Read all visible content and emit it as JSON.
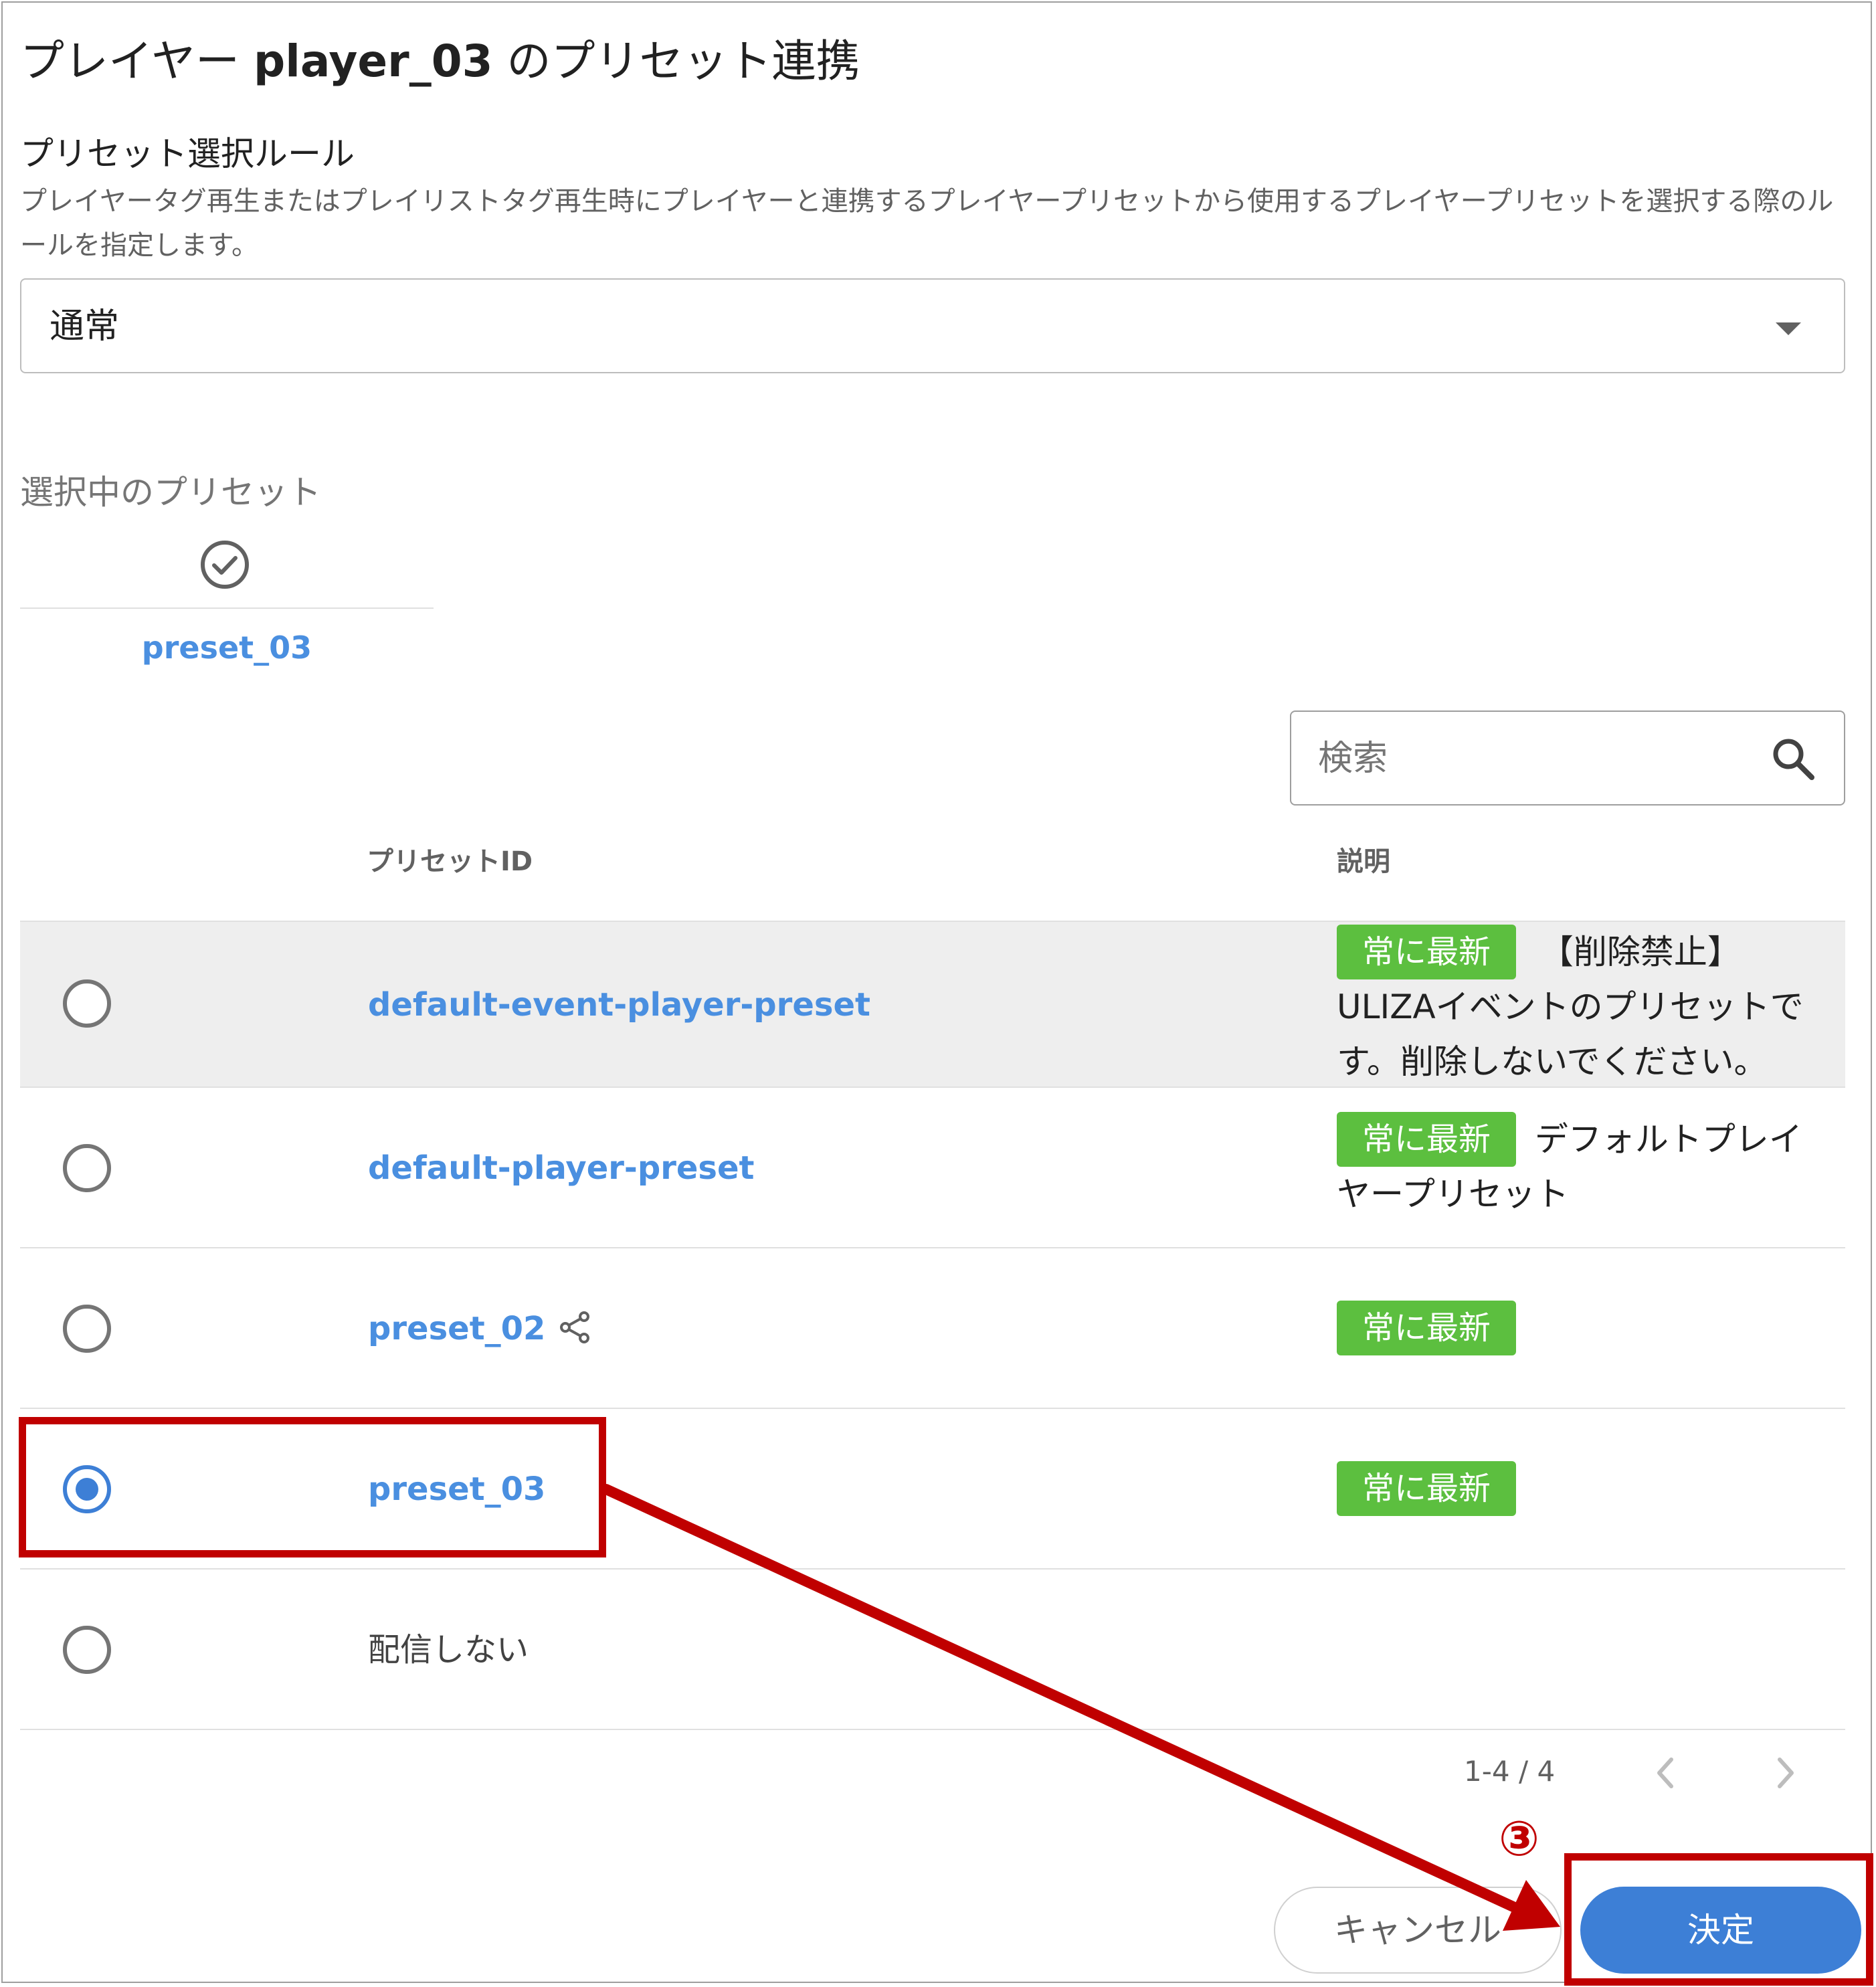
{
  "dialog": {
    "title_prefix": "プレイヤー ",
    "title_player": "player_03",
    "title_suffix": " のプリセット連携"
  },
  "rule": {
    "label": "プリセット選択ルール",
    "description": "プレイヤータグ再生またはプレイリストタグ再生時にプレイヤーと連携するプレイヤープリセットから使用するプレイヤープリセットを選択する際のルールを指定します。",
    "selected_value": "通常"
  },
  "selected_preset": {
    "heading": "選択中のプリセット",
    "name": "preset_03",
    "icon": "check-circle-icon"
  },
  "search": {
    "placeholder": "検索",
    "icon": "search-icon"
  },
  "table": {
    "columns": [
      "プリセットID",
      "説明"
    ],
    "rows": [
      {
        "id": "default-event-player-preset",
        "selected": false,
        "highlighted": true,
        "badge": "常に最新",
        "desc_line1": "【削除禁止】",
        "desc_rest": "ULIZAイベントのプリセットです。削除しないでください。"
      },
      {
        "id": "default-player-preset",
        "selected": false,
        "highlighted": false,
        "badge": "常に最新",
        "desc_line1": "デフォルトプレイ",
        "desc_rest": "ヤープリセット"
      },
      {
        "id": "preset_02",
        "selected": false,
        "highlighted": false,
        "badge": "常に最新",
        "shared": true,
        "icon": "share-icon"
      },
      {
        "id": "preset_03",
        "selected": true,
        "highlighted": false,
        "badge": "常に最新"
      },
      {
        "id": "配信しない",
        "selected": false,
        "highlighted": false
      }
    ]
  },
  "pagination": {
    "range": "1-4 / 4",
    "prev_icon": "chevron-left-icon",
    "next_icon": "chevron-right-icon"
  },
  "actions": {
    "cancel": "キャンセル",
    "confirm": "決定"
  },
  "annotation": {
    "step": "③",
    "color": "#c00000"
  },
  "colors": {
    "link": "#4a8fe0",
    "badge": "#5cbf3f",
    "primary": "#3d7fd6",
    "row_highlight": "#eeeeee"
  }
}
